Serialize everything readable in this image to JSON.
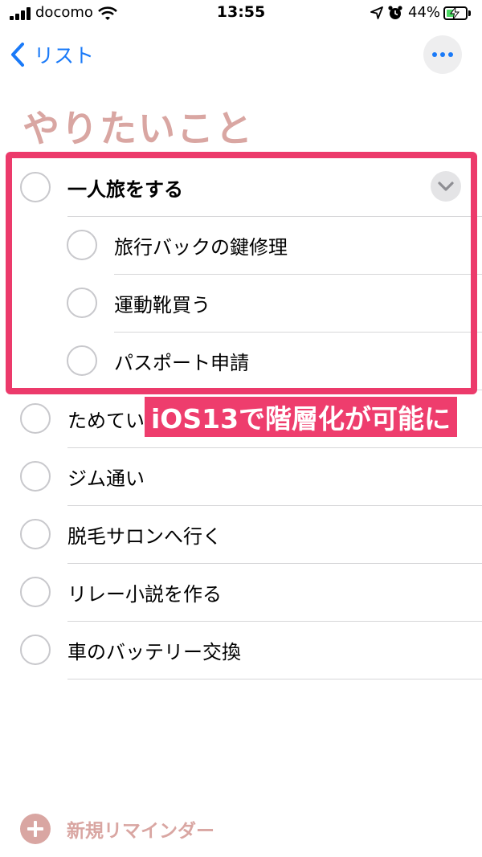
{
  "status_bar": {
    "carrier": "docomo",
    "time": "13:55",
    "battery_percent": "44%",
    "battery_level": 0.44,
    "icons": [
      "signal-icon",
      "wifi-icon",
      "location-icon",
      "alarm-icon",
      "battery-icon",
      "charging-icon"
    ]
  },
  "nav": {
    "back_label": "リスト",
    "more_icon": "ellipsis-icon"
  },
  "list": {
    "title": "やりたいこと",
    "title_color": "#d9a6a2",
    "parent": {
      "label": "一人旅をする",
      "expanded": true,
      "subtasks": [
        {
          "label": "旅行バックの鍵修理"
        },
        {
          "label": "運動靴買う"
        },
        {
          "label": "パスポート申請"
        }
      ]
    },
    "items": [
      {
        "label": "ためていたドラマを観る"
      },
      {
        "label": "ジム通い"
      },
      {
        "label": "脱毛サロンへ行く"
      },
      {
        "label": "リレー小説を作る"
      },
      {
        "label": "車のバッテリー交換"
      }
    ]
  },
  "annotation": {
    "caption": "iOS13で階層化が可能に",
    "color": "#ec3a6b"
  },
  "footer": {
    "new_reminder_label": "新規リマインダー"
  },
  "colors": {
    "accent_blue": "#1a7af8",
    "highlight_pink": "#ec3a6b",
    "battery_green": "#4cd964"
  }
}
